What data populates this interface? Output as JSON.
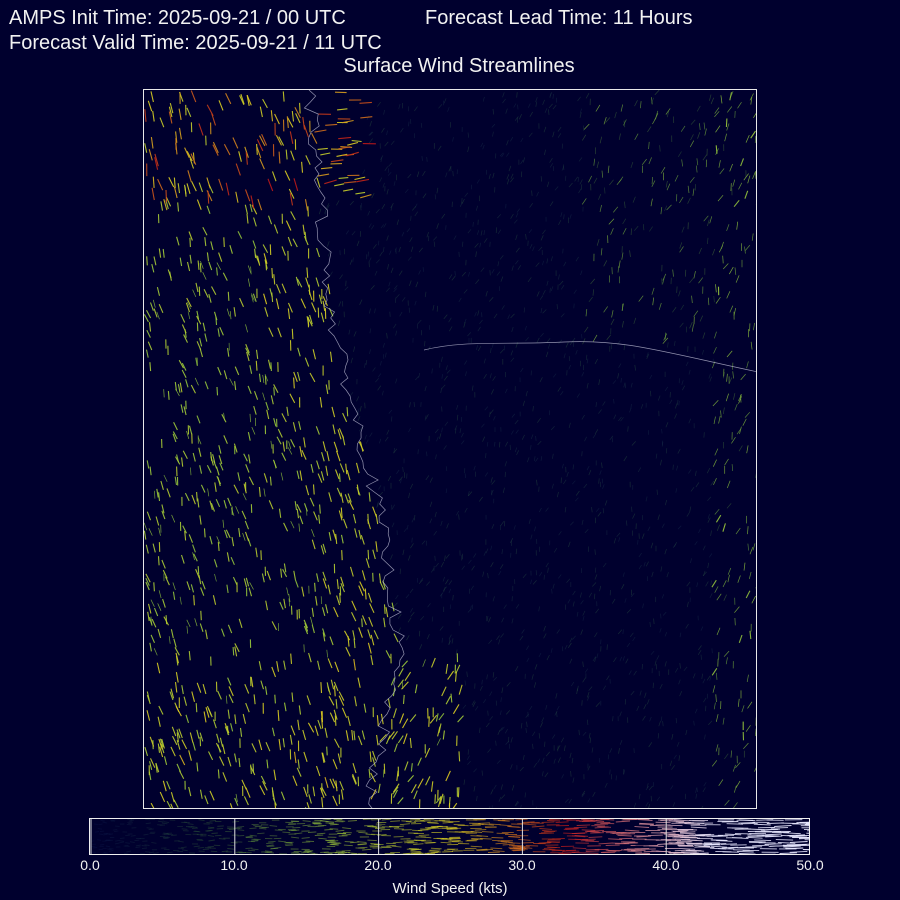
{
  "header": {
    "init_time": "AMPS Init Time: 2025-09-21 / 00 UTC",
    "lead_time": "Forecast Lead Time: 11 Hours",
    "valid_time": "Forecast Valid Time: 2025-09-21 / 11 UTC",
    "title": "Surface Wind Streamlines"
  },
  "colorbar": {
    "label": "Wind Speed (kts)",
    "range": [
      0,
      50
    ],
    "ticks": [
      "0.0",
      "10.0",
      "20.0",
      "30.0",
      "40.0",
      "50.0"
    ],
    "colors": {
      "calm": "#0a1550",
      "light": "#2f5a3a",
      "moderate": "#9acb3c",
      "strong": "#e0d020",
      "gale": "#c01818",
      "storm": "#e8e8ff"
    }
  },
  "colors": {
    "background": "#00002e",
    "frame": "#e8e8e8",
    "coastline": "#b8b8d0"
  }
}
